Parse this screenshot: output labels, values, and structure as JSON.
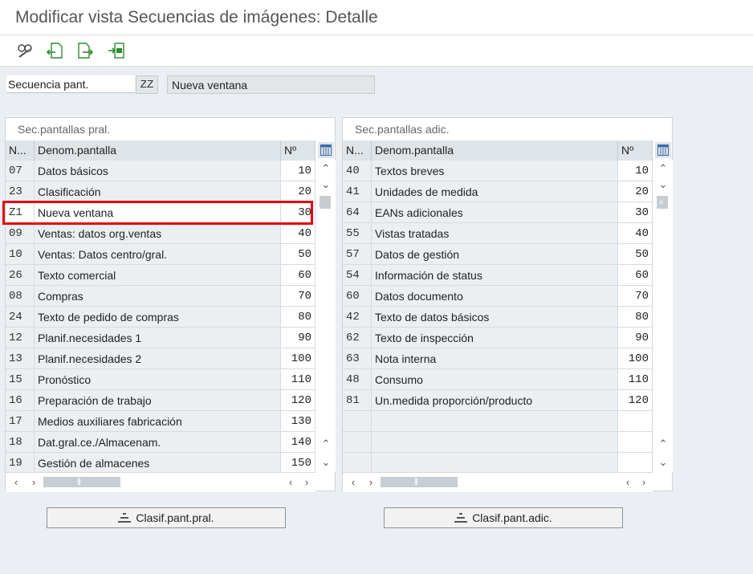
{
  "window": {
    "title": "Modificar vista Secuencias de imágenes: Detalle"
  },
  "toolbar": {
    "icons": [
      "display-change-icon",
      "previous-entry-icon",
      "next-entry-icon",
      "select-block-icon"
    ]
  },
  "header": {
    "label": "Secuencia pant.",
    "key": "ZZ",
    "description": "Nueva ventana"
  },
  "left_table": {
    "title": "Sec.pantallas pral.",
    "columns": [
      "N...",
      "Denom.pantalla",
      "Nº"
    ],
    "rows": [
      {
        "n": "07",
        "name": "Datos básicos",
        "no": "10"
      },
      {
        "n": "23",
        "name": "Clasificación",
        "no": "20"
      },
      {
        "n": "Z1",
        "name": "Nueva ventana",
        "no": "30"
      },
      {
        "n": "09",
        "name": "Ventas: datos org.ventas",
        "no": "40"
      },
      {
        "n": "10",
        "name": "Ventas: Datos centro/gral.",
        "no": "50"
      },
      {
        "n": "26",
        "name": "Texto comercial",
        "no": "60"
      },
      {
        "n": "08",
        "name": "Compras",
        "no": "70"
      },
      {
        "n": "24",
        "name": "Texto de pedido de compras",
        "no": "80"
      },
      {
        "n": "12",
        "name": "Planif.necesidades 1",
        "no": "90"
      },
      {
        "n": "13",
        "name": "Planif.necesidades 2",
        "no": "100"
      },
      {
        "n": "15",
        "name": "Pronóstico",
        "no": "110"
      },
      {
        "n": "16",
        "name": "Preparación de trabajo",
        "no": "120"
      },
      {
        "n": "17",
        "name": "Medios auxiliares fabricación",
        "no": "130"
      },
      {
        "n": "18",
        "name": "Dat.gral.ce./Almacenam.",
        "no": "140"
      },
      {
        "n": "19",
        "name": "Gestión de almacenes",
        "no": "150"
      }
    ]
  },
  "right_table": {
    "title": "Sec.pantallas adic.",
    "columns": [
      "N...",
      "Denom.pantalla",
      "Nº"
    ],
    "rows": [
      {
        "n": "40",
        "name": "Textos breves",
        "no": "10"
      },
      {
        "n": "41",
        "name": "Unidades de medida",
        "no": "20"
      },
      {
        "n": "64",
        "name": "EANs adicionales",
        "no": "30"
      },
      {
        "n": "55",
        "name": "Vistas tratadas",
        "no": "40"
      },
      {
        "n": "57",
        "name": "Datos de gestión",
        "no": "50"
      },
      {
        "n": "54",
        "name": "Información de status",
        "no": "60"
      },
      {
        "n": "60",
        "name": "Datos documento",
        "no": "70"
      },
      {
        "n": "42",
        "name": "Texto de datos básicos",
        "no": "80"
      },
      {
        "n": "62",
        "name": "Texto de inspección",
        "no": "90"
      },
      {
        "n": "63",
        "name": "Nota interna",
        "no": "100"
      },
      {
        "n": "48",
        "name": "Consumo",
        "no": "110"
      },
      {
        "n": "81",
        "name": "Un.medida proporción/producto",
        "no": "120"
      },
      {
        "n": "",
        "name": "",
        "no": ""
      },
      {
        "n": "",
        "name": "",
        "no": ""
      },
      {
        "n": "",
        "name": "",
        "no": ""
      }
    ]
  },
  "buttons": {
    "left": "Clasif.pant.pral.",
    "right": "Clasif.pant.adic."
  },
  "colors": {
    "highlight": "#e30613",
    "toolbar_green": "#2e8b2e"
  }
}
